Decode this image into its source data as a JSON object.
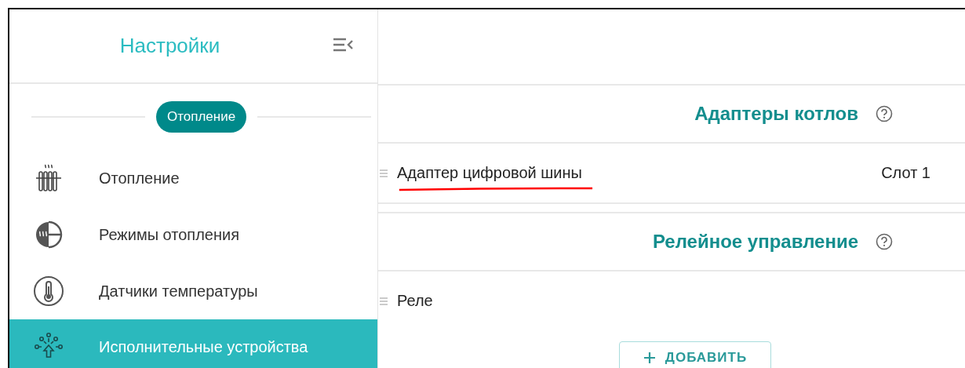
{
  "sidebar": {
    "title": "Настройки",
    "group_label": "Отопление",
    "items": [
      {
        "label": "Отопление",
        "kind": "radiator",
        "selected": false
      },
      {
        "label": "Режимы отопления",
        "kind": "modes",
        "selected": false
      },
      {
        "label": "Датчики температуры",
        "kind": "thermometer",
        "selected": false
      },
      {
        "label": "Исполнительные устройства",
        "kind": "actuators",
        "selected": true
      }
    ]
  },
  "sections": [
    {
      "title": "Адаптеры котлов",
      "rows": [
        {
          "name": "Адаптер цифровой шины",
          "slot": "Слот 1",
          "underlined": true
        }
      ]
    },
    {
      "title": "Релейное управление",
      "rows": [
        {
          "name": "Реле",
          "underlined": false
        }
      ],
      "add_button": "ДОБАВИТЬ"
    }
  ]
}
